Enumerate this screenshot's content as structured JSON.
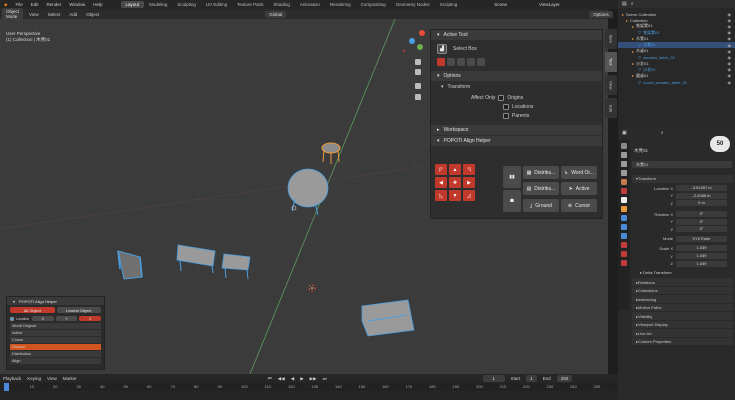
{
  "menu": {
    "items": [
      "File",
      "Edit",
      "Render",
      "Window",
      "Help"
    ],
    "workspaces": [
      "Layout",
      "Modeling",
      "Sculpting",
      "UV Editing",
      "Texture Paint",
      "Shading",
      "Animation",
      "Rendering",
      "Compositing",
      "Geometry Nodes",
      "Scripting"
    ],
    "active_workspace": "Layout",
    "scene": "Scene",
    "view_layer": "ViewLayer"
  },
  "viewport_header": {
    "mode": "Object Mode",
    "menus": [
      "View",
      "Select",
      "Add",
      "Object"
    ],
    "orientation": "Global",
    "options": "Options"
  },
  "viewport_info": {
    "line1": "User Perspective",
    "line2": "(1) Collection | 木凳01"
  },
  "tool_panel": {
    "active_tool_title": "Active Tool",
    "tool_name": "Select Box",
    "options_title": "Options",
    "transform_title": "Transform",
    "affect_only": "Affect Only",
    "origins": "Origins",
    "locations": "Locations",
    "parents": "Parents",
    "workspace_title": "Workspace",
    "popoti_title": "POPOTI Align Helper"
  },
  "align_buttons": {
    "distribute1": "Distribu...",
    "word_or": "Word Or...",
    "distribute2": "Distribu...",
    "active": "Active",
    "ground": "Ground",
    "cursor": "Cursor"
  },
  "side_tabs": [
    "Item",
    "Tool",
    "View",
    "Edit"
  ],
  "left_panel": {
    "title": "POPOTI Align Helper",
    "all_object": "All Object",
    "lowest_object": "Lowest Object",
    "location_label": "Location",
    "x": "X",
    "y": "Y",
    "z": "Z",
    "list": [
      "World Original",
      "Active",
      "Cursor",
      "Ground",
      "Distribution",
      "Align"
    ],
    "selected": "Ground"
  },
  "outliner": {
    "title": "Scene Collection",
    "rows": [
      {
        "name": "Scene Collection",
        "blue": false
      },
      {
        "name": "Collection",
        "blue": false
      },
      {
        "name": "铁架凳01",
        "blue": false
      },
      {
        "name": "铁架凳01",
        "blue": true
      },
      {
        "name": "木凳01",
        "blue": false
      },
      {
        "name": "木凳01",
        "blue": true
      },
      {
        "name": "木桌01",
        "blue": false
      },
      {
        "name": "wooden_table_02",
        "blue": true
      },
      {
        "name": "沙发01",
        "blue": false
      },
      {
        "name": "沙发01",
        "blue": true
      },
      {
        "name": "圆桌01",
        "blue": false
      },
      {
        "name": "round_wooden_table_01",
        "blue": true
      }
    ]
  },
  "properties": {
    "object_name": "木凳01",
    "badge": "50",
    "transform": "Transform",
    "location_x": "-3.91357 m",
    "location_y": "-2.2085 m",
    "location_z": "0 m",
    "rotation_x": "0°",
    "rotation_y": "0°",
    "rotation_z": "0°",
    "mode": "XYZ Euler",
    "scale_x": "1.039",
    "scale_y": "1.039",
    "scale_z": "1.039",
    "lbl_location": "Location X",
    "lbl_rotation": "Rotation X",
    "lbl_mode": "Mode",
    "lbl_scale": "Scale X",
    "lbl_y": "Y",
    "lbl_z": "Z",
    "delta": "Delta Transform",
    "sections": [
      "Relations",
      "Collections",
      "Instancing",
      "Motion Paths",
      "Visibility",
      "Viewport Display",
      "Line Art",
      "Custom Properties"
    ]
  },
  "timeline": {
    "playback": "Playback",
    "keying": "Keying",
    "view": "View",
    "marker": "Marker",
    "current": "1",
    "start_label": "Start",
    "start": "1",
    "end_label": "End",
    "end": "250",
    "ticks": [
      "0",
      "10",
      "20",
      "30",
      "40",
      "50",
      "60",
      "70",
      "80",
      "90",
      "100",
      "110",
      "120",
      "130",
      "140",
      "150",
      "160",
      "170",
      "180",
      "190",
      "200",
      "210",
      "220",
      "230",
      "240",
      "250"
    ]
  },
  "colors": {
    "accent": "#c0392b",
    "selection_blue": "#4a9fe0",
    "active_orange": "#e89a3c",
    "ground_highlight": "#d2541e"
  }
}
